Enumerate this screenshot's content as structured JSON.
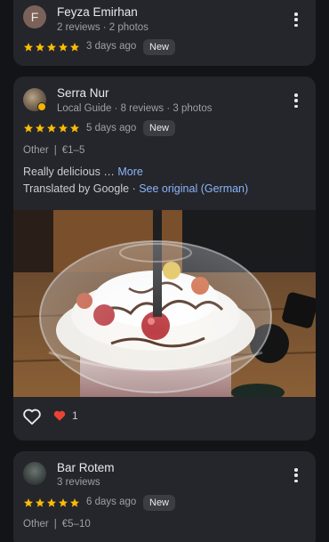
{
  "reviews": [
    {
      "avatar_letter": "F",
      "name": "Feyza Emirhan",
      "meta": "2 reviews · 2 photos",
      "rating": 5,
      "time_ago": "3 days ago",
      "tag": "New"
    },
    {
      "name": "Serra Nur",
      "meta": "Local Guide · 8 reviews · 3 photos",
      "rating": 5,
      "time_ago": "5 days ago",
      "tag": "New",
      "category": "Other",
      "price": "€1–5",
      "text": "Really delicious",
      "ellipsis": "…",
      "more_label": "More",
      "translated_label": "Translated by Google",
      "translated_sep": "·",
      "see_original_label": "See original (German)",
      "reaction_count": "1"
    },
    {
      "name": "Bar Rotem",
      "meta": "3 reviews",
      "rating": 5,
      "time_ago": "6 days ago",
      "tag": "New",
      "category": "Other",
      "price": "€5–10"
    }
  ],
  "category_separator": "|",
  "colors": {
    "background": "#131418",
    "card": "#25262b",
    "star": "#fbbc04",
    "link": "#8ab4f8",
    "heart_reaction": "#ea4335"
  },
  "icons": [
    "kebab-menu-icon",
    "star-icon",
    "heart-outline-icon",
    "heart-filled-icon",
    "local-guide-badge-icon"
  ]
}
